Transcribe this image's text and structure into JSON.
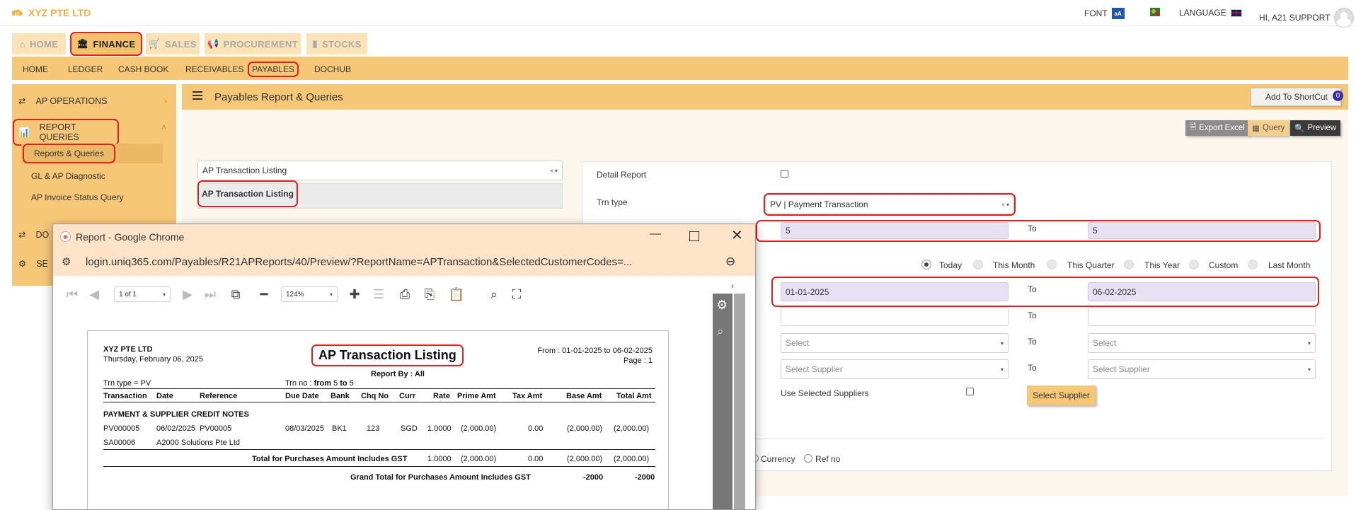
{
  "app": {
    "title": "XYZ PTE LTD"
  },
  "topbar": {
    "font_label": "FONT",
    "font_icon": "aA",
    "language_label": "LANGUAGE",
    "greeting": "HI, A21 SUPPORT"
  },
  "modules": [
    {
      "label": "HOME",
      "icon": "home-icon"
    },
    {
      "label": "FINANCE",
      "icon": "bank-icon"
    },
    {
      "label": "SALES",
      "icon": "cart-icon"
    },
    {
      "label": "PROCUREMENT",
      "icon": "megaphone-icon"
    },
    {
      "label": "STOCKS",
      "icon": "bar-chart-icon"
    }
  ],
  "subnav": [
    "HOME",
    "LEDGER",
    "CASH BOOK",
    "RECEIVABLES",
    "PAYABLES",
    "DOCHUB"
  ],
  "sidebar": {
    "ap_operations": "AP OPERATIONS",
    "report_queries": "REPORT QUERIES",
    "sub_items": [
      "Reports & Queries",
      "GL & AP Diagnostic",
      "AP Invoice Status Query"
    ],
    "dochub": "DO",
    "settings": "SE"
  },
  "main": {
    "title": "Payables Report & Queries",
    "shortcut_label": "Add To ShortCut",
    "shortcut_count": "0",
    "export_label": "Export Excel",
    "query_label": "Query",
    "preview_label": "Preview",
    "report_select": "AP Transaction Listing",
    "report_option": "AP Transaction Listing"
  },
  "form": {
    "detail_report": "Detail Report",
    "trn_type_label": "Trn type",
    "trn_type_value": "PV | Payment Transaction",
    "trn_from": "5",
    "trn_to": "5",
    "to_label": "To",
    "period_options": [
      "Today",
      "This Month",
      "This Quarter",
      "This Year",
      "Custom",
      "Last Month"
    ],
    "date_from": "01-01-2025",
    "date_to": "06-02-2025",
    "select_placeholder": "Select",
    "supplier_placeholder": "Select Supplier",
    "use_selected_suppliers": "Use Selected Suppliers",
    "select_supplier_button": "Select Supplier",
    "sort_currency": "Currency",
    "sort_refno": "Ref no"
  },
  "popup": {
    "title": "Report - Google Chrome",
    "url": "login.uniq365.com/Payables/R21APReports/40/Preview/?ReportName=APTransaction&SelectedCustomerCodes=...",
    "page_indicator": "1 of 1",
    "zoom": "124%"
  },
  "report": {
    "company": "XYZ PTE LTD",
    "date": "Thursday, February 06, 2025",
    "title": "AP Transaction Listing",
    "range": "From : 01-01-2025 to 06-02-2025",
    "page": "Page : 1",
    "report_by": "Report By : All",
    "trn_type": "Trn type = PV",
    "trn_no_prefix": "Trn no :",
    "trn_no_from": "from",
    "trn_no_from_val": "5",
    "trn_no_to": "to",
    "trn_no_to_val": "5",
    "columns": [
      "Transaction",
      "Date",
      "Reference",
      "Due Date",
      "Bank",
      "Chq No",
      "Curr",
      "Rate",
      "Prime Amt",
      "Tax Amt",
      "Base Amt",
      "Total Amt"
    ],
    "section": "PAYMENT & SUPPLIER CREDIT NOTES",
    "row": [
      "PV000005",
      "06/02/2025",
      "PV00005",
      "08/03/2025",
      "BK1",
      "123",
      "SGD",
      "1.0000",
      "(2,000.00)",
      "0.00",
      "(2,000.00)",
      "(2,000.00)"
    ],
    "row2_supplier_code": "SA00006",
    "row2_supplier_name": "A2000 Solutions Pte Ltd",
    "total_label": "Total for Purchases Amount Includes GST",
    "total": [
      "1.0000",
      "(2,000.00)",
      "0.00",
      "(2,000.00)",
      "(2,000.00)"
    ],
    "grand_label": "Grand Total for Purchases Amount Includes GST",
    "grand": [
      "-2000",
      "-2000"
    ]
  },
  "colors": {
    "accent": "#f7c778",
    "tab_active": "#f4c26d",
    "highlight": "#e02020",
    "input_fill": "#e8e1f3",
    "popup_title": "#fde3c8"
  }
}
